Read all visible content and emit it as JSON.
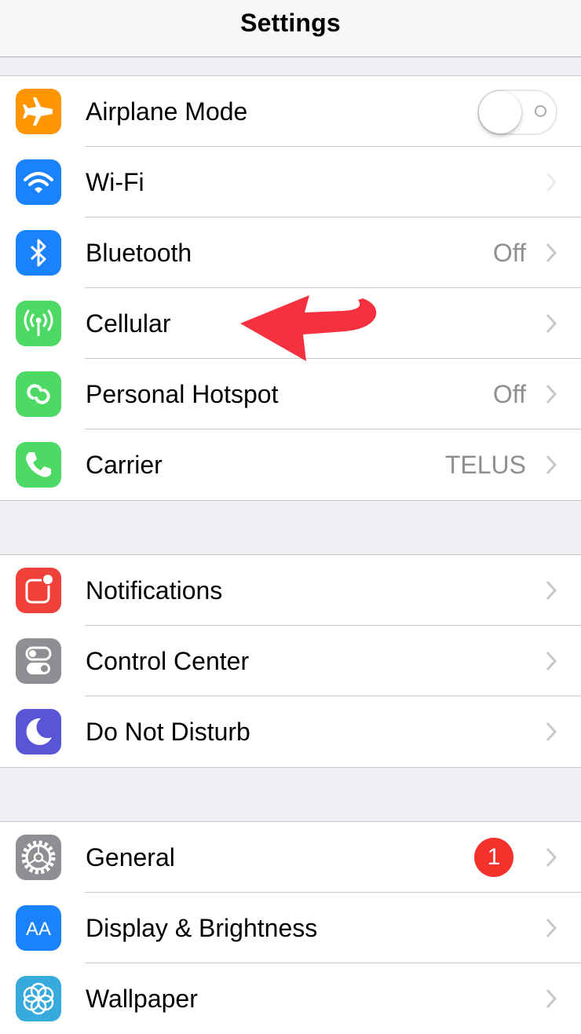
{
  "navbar": {
    "title": "Settings"
  },
  "colors": {
    "orange": "#ff9500",
    "blue": "#1a82fb",
    "green": "#4cd964",
    "red": "#f0403a",
    "gray": "#8e8e93",
    "purple": "#5856d6",
    "annotation_arrow": "#f5303f",
    "badge": "#f4312a"
  },
  "group1": {
    "airplane": {
      "label": "Airplane Mode",
      "icon": "airplane-icon",
      "toggle": "off"
    },
    "wifi": {
      "label": "Wi-Fi",
      "icon": "wifi-icon"
    },
    "bluetooth": {
      "label": "Bluetooth",
      "value": "Off",
      "icon": "bluetooth-icon"
    },
    "cellular": {
      "label": "Cellular",
      "icon": "antenna-icon"
    },
    "hotspot": {
      "label": "Personal Hotspot",
      "value": "Off",
      "icon": "hotspot-icon"
    },
    "carrier": {
      "label": "Carrier",
      "value": "TELUS",
      "icon": "phone-icon"
    }
  },
  "group2": {
    "notifications": {
      "label": "Notifications",
      "icon": "notifications-icon"
    },
    "control_center": {
      "label": "Control Center",
      "icon": "switches-icon"
    },
    "dnd": {
      "label": "Do Not Disturb",
      "icon": "moon-icon"
    }
  },
  "group3": {
    "general": {
      "label": "General",
      "badge": "1",
      "icon": "gear-icon"
    },
    "display": {
      "label": "Display & Brightness",
      "icon": "aa-icon",
      "icon_text": "AA"
    },
    "wallpaper": {
      "label": "Wallpaper",
      "icon": "flower-icon"
    }
  }
}
